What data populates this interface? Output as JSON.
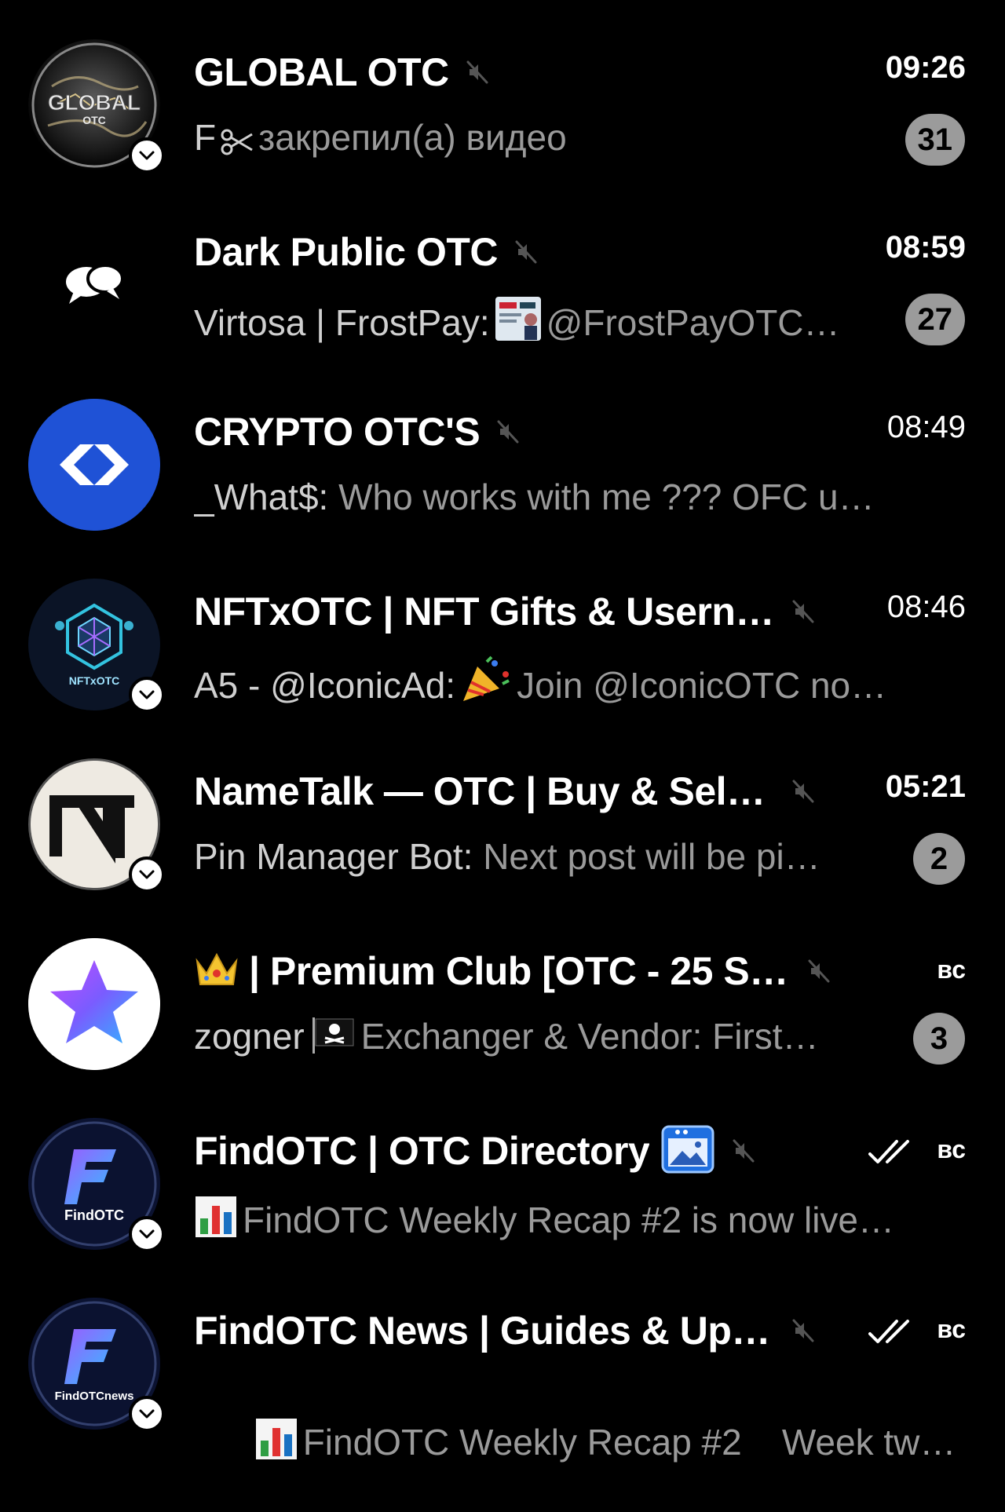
{
  "colors": {
    "background": "#000000",
    "title": "#ffffff",
    "preview": "#9a9a9a",
    "sender": "#cfcfcf",
    "badge_bg": "#9b9b9b"
  },
  "chats": [
    {
      "avatar_icon": "globe-logo-icon",
      "avatar_text": "GLOBAL",
      "avatar_subtext": "OTC",
      "title": "GLOBAL OTC",
      "muted": true,
      "time": "09:26",
      "sender": "F",
      "sender_icon": "scissors-icon",
      "message": "закрепил(а) видео",
      "unread": "31"
    },
    {
      "avatar_icon": "speech-bubbles-icon",
      "title": "Dark Public OTC",
      "muted": true,
      "time": "08:59",
      "sender": "Virtosa | FrostPay:",
      "message_icon": "photo-thumbnail-icon",
      "message": "@FrostPayOTC…",
      "unread": "27"
    },
    {
      "avatar_icon": "diamond-arrows-logo-icon",
      "title": "CRYPTO OTC'S",
      "muted": true,
      "time": "08:49",
      "sender": "_What$:",
      "message": "Who works with me ???  OFC u…"
    },
    {
      "avatar_icon": "gift-cube-logo-icon",
      "avatar_text": "NFTxOTC",
      "title": "NFTxOTC | NFT Gifts & Userna…",
      "muted": true,
      "time": "08:46",
      "sender": "A5 - @IconicAd:",
      "message_icon": "party-popper-icon",
      "message": "Join @IconicOTC no…"
    },
    {
      "avatar_icon": "nt-monogram-icon",
      "title": "NameTalk — OTC | Buy & Sell •…",
      "muted": true,
      "time": "05:21",
      "sender": "Pin Manager Bot:",
      "message": "Next post will be pi…",
      "unread": "2"
    },
    {
      "avatar_icon": "star-logo-icon",
      "title_icon": "crown-icon",
      "title": "| Premium Club [OTC - 25 STA…",
      "muted": true,
      "time": "вс",
      "sender": "zogner",
      "sender_icon": "pirate-flag-icon",
      "message": "Exchanger & Vendor: First…",
      "unread": "3"
    },
    {
      "avatar_icon": "findotc-logo-icon",
      "avatar_text": "FindOTC",
      "title": "FindOTC | OTC Directory",
      "title_after_icon": "picture-frame-icon",
      "muted": true,
      "read": true,
      "time": "вс",
      "message_icon": "bar-chart-icon",
      "message": "FindOTC Weekly Recap #2 is now live…"
    },
    {
      "avatar_icon": "findotc-logo-icon",
      "avatar_text": "FindOTCnews",
      "title": "FindOTC News | Guides & Upd…",
      "muted": true,
      "read": true,
      "time": "вс",
      "message_icon": "bar-chart-icon",
      "message": "FindOTC Weekly Recap #2    Week tw…"
    }
  ]
}
